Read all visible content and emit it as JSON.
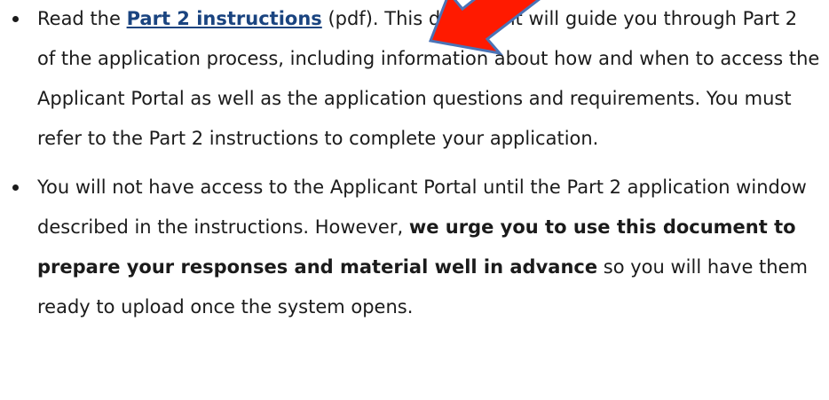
{
  "list": {
    "item1": {
      "prefix": "Read the ",
      "link_text": "Part 2 instructions",
      "middle": " (pdf). This document will guide you through Part 2 of the application process, including information about how and when to access the Applicant Portal as well as the application questions and requirements. You must refer to the Part 2 instructions to complete your application."
    },
    "item2": {
      "text_before": "You will not have access to the Applicant Portal until the Part 2 application window described in the instructions. However, ",
      "bold_text": "we urge you to use this document to prepare your responses and material well in advance",
      "text_after": " so you will have them ready to upload once the system opens."
    }
  },
  "colors": {
    "link": "#1a4480",
    "arrow_fill": "#ff1a00",
    "arrow_stroke": "#4a73b6"
  },
  "icons": {
    "annotation_arrow": "red-arrow-icon"
  }
}
